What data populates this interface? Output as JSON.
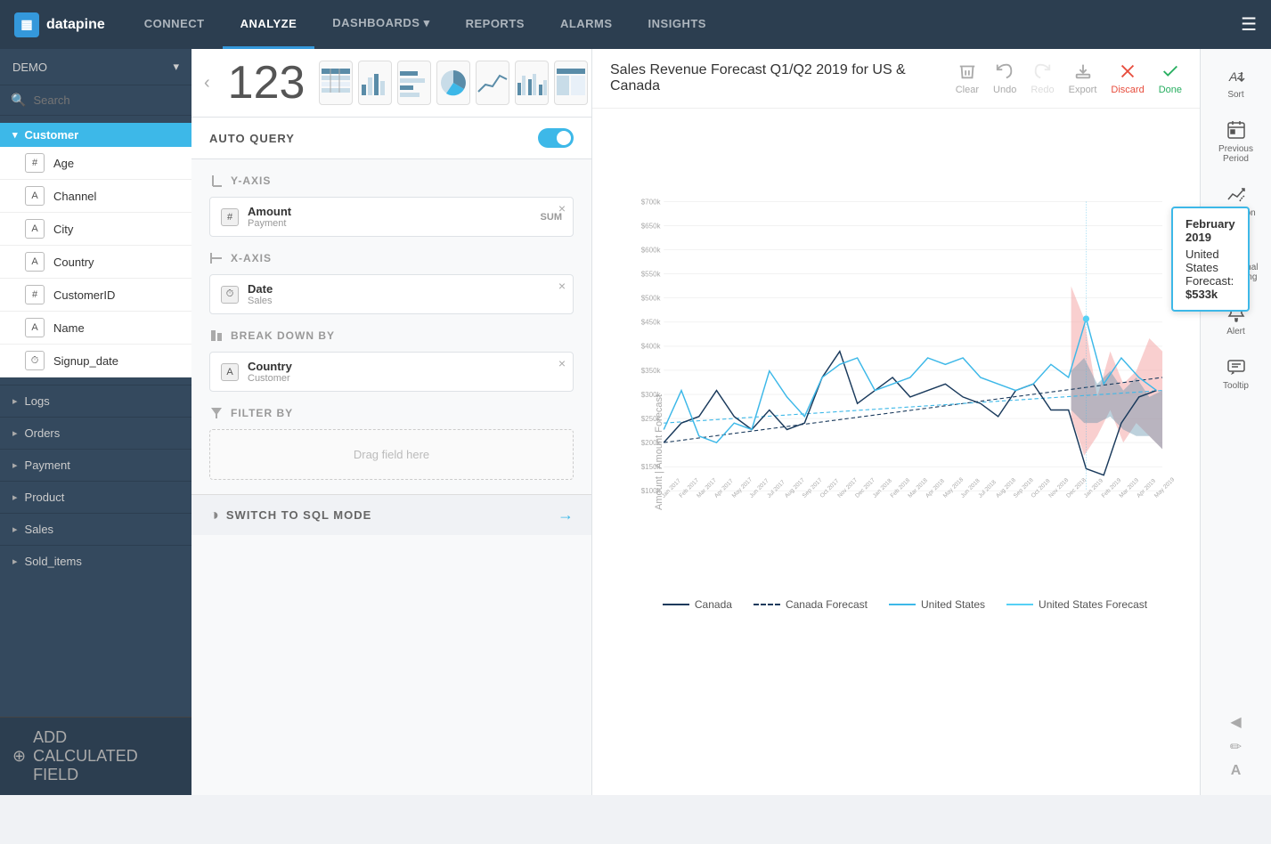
{
  "nav": {
    "logo_text": "datapine",
    "items": [
      {
        "label": "CONNECT",
        "active": false
      },
      {
        "label": "ANALYZE",
        "active": true
      },
      {
        "label": "DASHBOARDS ▾",
        "active": false
      },
      {
        "label": "REPORTS",
        "active": false
      },
      {
        "label": "ALARMS",
        "active": false
      },
      {
        "label": "INSIGHTS",
        "active": false
      }
    ]
  },
  "sidebar": {
    "demo_label": "DEMO",
    "search_placeholder": "Search",
    "groups": [
      {
        "label": "Customer",
        "expanded": true,
        "items": [
          {
            "type": "#",
            "label": "Age"
          },
          {
            "type": "A",
            "label": "Channel"
          },
          {
            "type": "A",
            "label": "City"
          },
          {
            "type": "A",
            "label": "Country"
          },
          {
            "type": "#",
            "label": "CustomerID"
          },
          {
            "type": "A",
            "label": "Name"
          },
          {
            "type": "⏱",
            "label": "Signup_date"
          }
        ]
      },
      {
        "label": "Logs",
        "expanded": false,
        "items": []
      },
      {
        "label": "Orders",
        "expanded": false,
        "items": []
      },
      {
        "label": "Payment",
        "expanded": false,
        "items": []
      },
      {
        "label": "Product",
        "expanded": false,
        "items": []
      },
      {
        "label": "Sales",
        "expanded": false,
        "items": []
      },
      {
        "label": "Sold_items",
        "expanded": false,
        "items": []
      }
    ],
    "add_calc_label": "ADD CALCULATED FIELD"
  },
  "query_panel": {
    "auto_query_label": "AUTO QUERY",
    "chart_number": "123",
    "y_axis_label": "Y-AXIS",
    "x_axis_label": "X-AXIS",
    "breakdown_label": "BREAK DOWN BY",
    "filter_label": "FILTER BY",
    "drop_hint": "Drag field here",
    "y_field": {
      "type": "#",
      "name": "Amount",
      "sub": "Payment",
      "agg": "SUM"
    },
    "x_field": {
      "type": "⏱",
      "name": "Date",
      "sub": "Sales"
    },
    "breakdown_field": {
      "type": "A",
      "name": "Country",
      "sub": "Customer"
    }
  },
  "chart": {
    "title": "Sales Revenue Forecast Q1/Q2 2019 for US & Canada",
    "toolbar": {
      "clear": "Clear",
      "undo": "Undo",
      "redo": "Redo",
      "export": "Export",
      "discard": "Discard",
      "done": "Done"
    },
    "tooltip": {
      "date": "February 2019",
      "label": "United States Forecast:",
      "value": "$533k"
    },
    "y_axis_labels": [
      "$700k",
      "$650k",
      "$600k",
      "$550k",
      "$500k",
      "$450k",
      "$400k",
      "$350k",
      "$300k",
      "$250k",
      "$200k",
      "$150k",
      "$100k"
    ],
    "x_axis_labels": [
      "January 2017",
      "February 2017",
      "March 2017",
      "April 2017",
      "May 2017",
      "June 2017",
      "July 2017",
      "August 2017",
      "September 2017",
      "October 2017",
      "November 2017",
      "December 2017",
      "January 2018",
      "February 2018",
      "March 2018",
      "April 2018",
      "May 2018",
      "June 2018",
      "July 2018",
      "August 2018",
      "September 2018",
      "October 2018",
      "November 2018",
      "December 2018",
      "January 2019",
      "February 2019",
      "March 2019",
      "April 2019",
      "May 2019",
      "June 2019"
    ],
    "legend": [
      {
        "label": "Canada",
        "style": "solid-dark"
      },
      {
        "label": "Canada Forecast",
        "style": "dashed-dark"
      },
      {
        "label": "United States",
        "style": "solid-blue"
      },
      {
        "label": "United States Forecast",
        "style": "solid-lightblue"
      }
    ],
    "y_axis_title": "Amount | Amount Forecast"
  },
  "right_panel": {
    "buttons": [
      {
        "icon": "sort",
        "label": "Sort"
      },
      {
        "icon": "previous-period",
        "label": "Previous Period"
      },
      {
        "icon": "prediction",
        "label": "Prediction"
      },
      {
        "icon": "conditional-formatting",
        "label": "Conditional Formatting"
      },
      {
        "icon": "alert",
        "label": "Alert"
      },
      {
        "icon": "tooltip",
        "label": "Tooltip"
      }
    ]
  },
  "sql_bar": {
    "label": "SWITCH TO SQL MODE"
  }
}
